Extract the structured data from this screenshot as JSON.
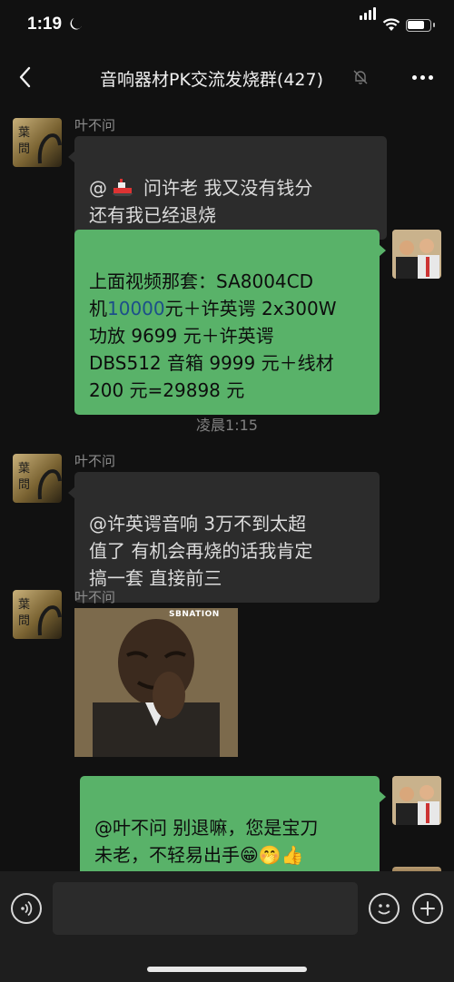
{
  "status_bar": {
    "time": "1:19"
  },
  "nav": {
    "title": "音响器材PK交流发烧群(427)"
  },
  "messages": [
    {
      "sender": "叶不问",
      "text": "问许老  我又没有钱分\n还有我已经退烧",
      "mention": "@"
    },
    {
      "sender": "self",
      "text_before": "上面视频那套：SA8004CD\n机",
      "text_link": "10000",
      "text_after": "元＋许英谔 2x300W\n功放 9699 元＋许英谔\nDBS512 音箱 9999 元＋线材\n200 元=29898 元"
    },
    {
      "sender": "叶不问",
      "text": "@许英谔音响   3万不到太超\n值了  有机会再烧的话我肯定\n搞一套  直接前三"
    },
    {
      "sender": "叶不问",
      "sticker_caption": "SBNATION"
    },
    {
      "sender": "self",
      "text": "@叶不问 别退嘛，您是宝刀\n未老，不轻易出手😁🤭👍"
    }
  ],
  "time_divider": "凌晨1:15",
  "input": {
    "placeholder": ""
  }
}
